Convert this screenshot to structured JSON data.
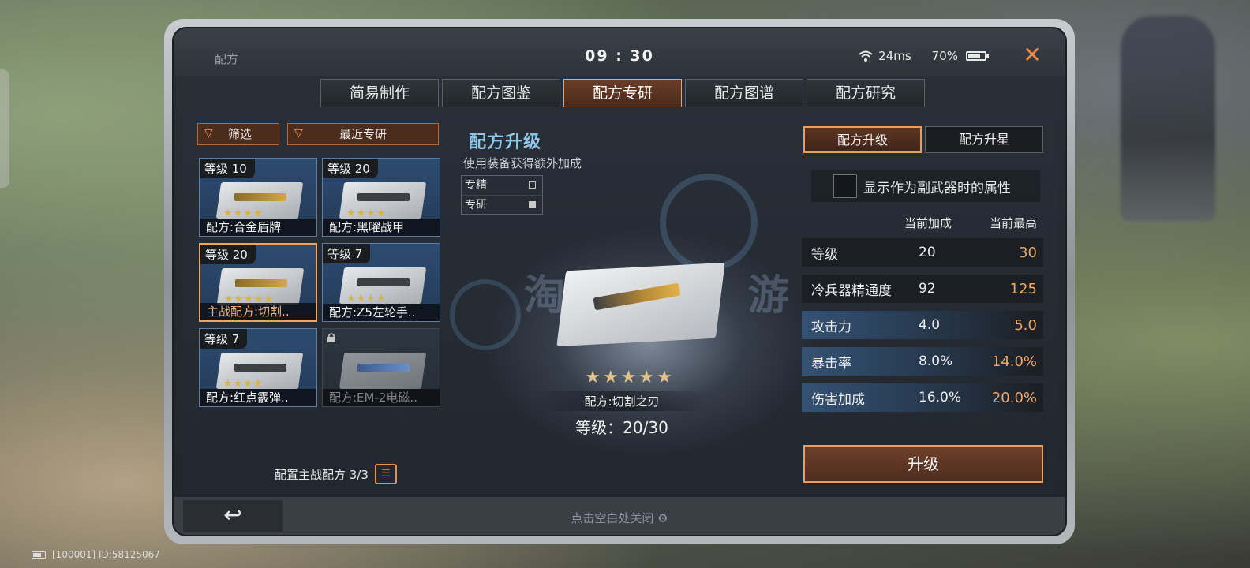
{
  "header": {
    "app_name": "配方",
    "time": "09 : 30",
    "ping": "24ms",
    "battery": "70%",
    "close_icon": "close-icon"
  },
  "tabs": [
    {
      "label": "简易制作",
      "active": false
    },
    {
      "label": "配方图鉴",
      "active": false
    },
    {
      "label": "配方专研",
      "active": true
    },
    {
      "label": "配方图谱",
      "active": false
    },
    {
      "label": "配方研究",
      "active": false
    }
  ],
  "left": {
    "filter_label": "筛选",
    "sort_label": "最近专研",
    "cards": [
      {
        "level": "等级 10",
        "name": "配方:合金盾牌"
      },
      {
        "level": "等级 20",
        "name": "配方:黑曜战甲"
      },
      {
        "level": "等级 20",
        "name": "主战配方:切割.."
      },
      {
        "level": "等级 7",
        "name": "配方:Z5左轮手.."
      },
      {
        "level": "等级 7",
        "name": "配方:红点霰弹.."
      },
      {
        "level": "",
        "name": "配方:EM-2电磁.."
      }
    ],
    "config_label": "配置主战配方 3/3"
  },
  "middle": {
    "title": "配方升级",
    "subtitle": "使用装备获得额外加成",
    "modes": [
      {
        "label": "专精",
        "checked": false
      },
      {
        "label": "专研",
        "checked": true
      }
    ],
    "stars": "★★★★★",
    "item_name": "配方:切割之刃",
    "item_level": "等级：20/30",
    "watermark": "淘手游"
  },
  "right": {
    "tab_upgrade": "配方升级",
    "tab_star": "配方升星",
    "secondary_toggle_label": "显示作为副武器时的属性",
    "col_current": "当前加成",
    "col_max": "当前最高",
    "stats": [
      {
        "name": "等级",
        "current": "20",
        "max": "30"
      },
      {
        "name": "冷兵器精通度",
        "current": "92",
        "max": "125"
      },
      {
        "name": "攻击力",
        "current": "4.0",
        "max": "5.0"
      },
      {
        "name": "暴击率",
        "current": "8.0%",
        "max": "14.0%"
      },
      {
        "name": "伤害加成",
        "current": "16.0%",
        "max": "20.0%"
      }
    ],
    "upgrade_button": "升级"
  },
  "bottom": {
    "hint": "点击空白处关闭",
    "back_icon": "back-arrow-icon"
  },
  "system": {
    "id_text": "[100001] ID:58125067"
  },
  "colors": {
    "accent": "#ea9d5c",
    "max_value": "#eea66a",
    "title_blue": "#8fc7ea"
  }
}
